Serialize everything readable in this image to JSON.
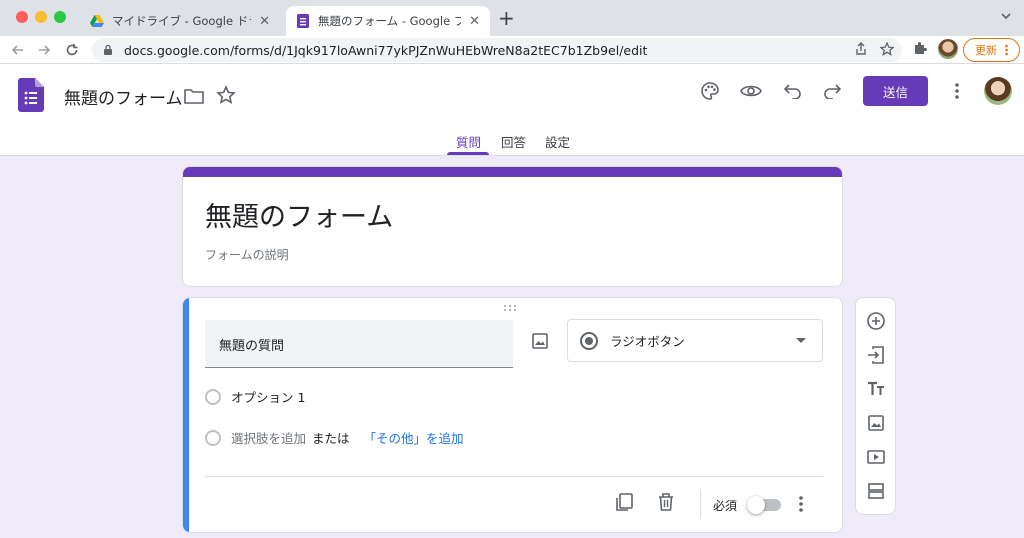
{
  "browser": {
    "tabs": [
      {
        "title": "マイドライブ - Google ドライブ",
        "close": "✕"
      },
      {
        "title": "無題のフォーム - Google フォーム",
        "close": "✕"
      }
    ],
    "new_tab": "+",
    "url": "docs.google.com/forms/d/1Jqk917loAwni77ykPJZnWuHEbWreN8a2tEC7b1Zb9el/edit",
    "update_label": "更新",
    "colors": {
      "close": "#ff5f57",
      "minimize": "#febc2e",
      "maximize": "#28c840"
    }
  },
  "header": {
    "doc_title": "無題のフォーム",
    "send_label": "送信",
    "tabs": [
      "質問",
      "回答",
      "設定"
    ],
    "accent": "#673ab7"
  },
  "form": {
    "title": "無題のフォーム",
    "description_placeholder": "フォームの説明"
  },
  "question": {
    "title": "無題の質問",
    "type_label": "ラジオボタン",
    "option1": "オプション 1",
    "add_option": "選択肢を追加",
    "or_text": "または",
    "add_other": "「その他」を追加",
    "required_label": "必須",
    "accent": "#4285f4"
  },
  "sidebar_icons": [
    "add-question-icon",
    "import-questions-icon",
    "add-title-icon",
    "add-image-icon",
    "add-video-icon",
    "add-section-icon"
  ]
}
